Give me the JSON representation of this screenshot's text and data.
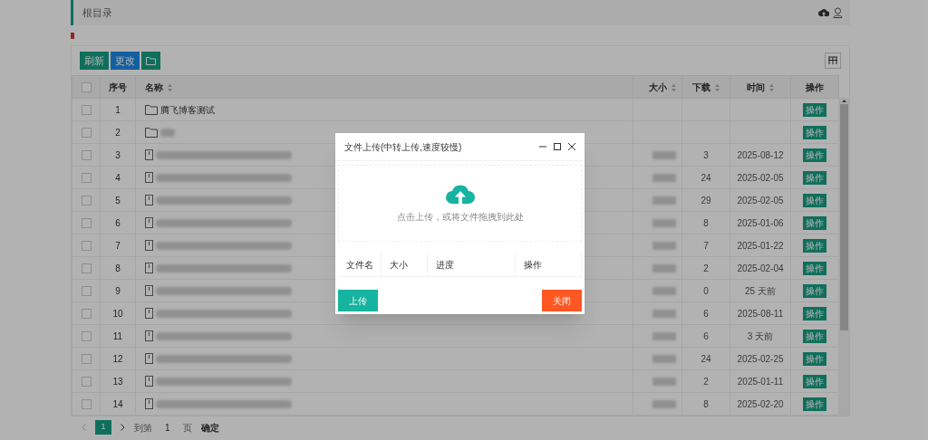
{
  "breadcrumb": "根目录",
  "toolbar": {
    "buttons": [
      {
        "label": "刷新",
        "kind": "refresh"
      },
      {
        "label": "更改",
        "kind": "change"
      },
      {
        "kind": "folder"
      }
    ]
  },
  "table": {
    "select_all_checked": false,
    "columns": [
      {
        "label": "序号",
        "sortable": false
      },
      {
        "label": "名称",
        "sortable": true
      },
      {
        "label": "大小",
        "sortable": true
      },
      {
        "label": "下载",
        "sortable": true
      },
      {
        "label": "时间",
        "sortable": true
      },
      {
        "label": "操作",
        "sortable": false
      }
    ],
    "rows": [
      {
        "index": "1",
        "checked": false,
        "kind": "folder",
        "name": "腾飞博客测试",
        "action": "操作"
      },
      {
        "index": "2",
        "checked": false,
        "kind": "folder",
        "redacted": true,
        "action": "操作"
      },
      {
        "index": "3",
        "checked": false,
        "kind": "file",
        "redacted": true,
        "downloads": "3",
        "time": "2025-08-12",
        "action": "操作"
      },
      {
        "index": "4",
        "checked": false,
        "kind": "file",
        "redacted": true,
        "downloads": "24",
        "time": "2025-02-05",
        "action": "操作"
      },
      {
        "index": "5",
        "checked": false,
        "kind": "file",
        "redacted": true,
        "downloads": "29",
        "time": "2025-02-05",
        "action": "操作"
      },
      {
        "index": "6",
        "checked": false,
        "kind": "file",
        "redacted": true,
        "downloads": "8",
        "time": "2025-01-06",
        "action": "操作"
      },
      {
        "index": "7",
        "checked": false,
        "kind": "file",
        "redacted": true,
        "downloads": "7",
        "time": "2025-01-22",
        "action": "操作"
      },
      {
        "index": "8",
        "checked": false,
        "kind": "file",
        "redacted": true,
        "downloads": "2",
        "time": "2025-02-04",
        "action": "操作"
      },
      {
        "index": "9",
        "checked": false,
        "kind": "file",
        "redacted": true,
        "downloads": "0",
        "time": "25 天前",
        "action": "操作"
      },
      {
        "index": "10",
        "checked": false,
        "kind": "file",
        "redacted": true,
        "downloads": "6",
        "time": "2025-08-11",
        "action": "操作"
      },
      {
        "index": "11",
        "checked": false,
        "kind": "file",
        "redacted": true,
        "downloads": "6",
        "time": "3 天前",
        "action": "操作"
      },
      {
        "index": "12",
        "checked": false,
        "kind": "file",
        "redacted": true,
        "downloads": "24",
        "time": "2025-02-25",
        "action": "操作"
      },
      {
        "index": "13",
        "checked": false,
        "kind": "file",
        "redacted": true,
        "downloads": "2",
        "time": "2025-01-11",
        "action": "操作"
      },
      {
        "index": "14",
        "checked": false,
        "kind": "file",
        "redacted": true,
        "downloads": "8",
        "time": "2025-02-20",
        "action": "操作"
      }
    ]
  },
  "pagination": {
    "pages": [
      {
        "label": "1",
        "selected": true
      }
    ],
    "goto_label": "到第",
    "goto_value": "1",
    "page_unit": "页",
    "confirm": "确定"
  },
  "dialog": {
    "title": "文件上传(中转上传,速度较慢)",
    "drop_hint": "点击上传，或将文件拖拽到此处",
    "columns": [
      "文件名",
      "大小",
      "进度",
      "操作"
    ],
    "upload_button": "上传",
    "close_button": "关闭"
  }
}
